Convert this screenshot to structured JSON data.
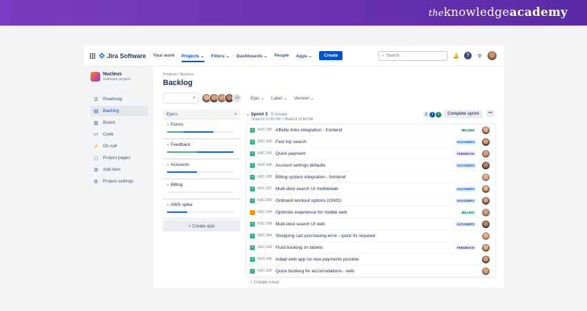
{
  "brand": {
    "part1": "the",
    "part2": "knowledge",
    "part3": "academy"
  },
  "topnav": {
    "product": "Jira Software",
    "items": [
      "Your work",
      "Projects ⌄",
      "Filters ⌄",
      "Dashboards ⌄",
      "People",
      "Apps ⌄"
    ],
    "active_index": 1,
    "create_label": "Create",
    "search_placeholder": "Search"
  },
  "sidebar": {
    "project_name": "Nucleus",
    "project_type": "Software project",
    "items": [
      {
        "label": "Roadmap",
        "icon": "roadmap-icon"
      },
      {
        "label": "Backlog",
        "icon": "backlog-icon"
      },
      {
        "label": "Board",
        "icon": "board-icon"
      },
      {
        "label": "Code",
        "icon": "code-icon"
      },
      {
        "label": "On-call",
        "icon": "on-call-icon"
      },
      {
        "label": "Project pages",
        "icon": "pages-icon"
      },
      {
        "label": "Add item",
        "icon": "add-item-icon"
      },
      {
        "label": "Project settings",
        "icon": "settings-icon"
      }
    ],
    "active_index": 1
  },
  "main": {
    "breadcrumb": "Projects / Nucleus",
    "title": "Backlog",
    "avatar_overflow": "+3",
    "filters": [
      "Epic ⌄",
      "Label ⌄",
      "Version ⌄"
    ]
  },
  "epics": {
    "header": "Epics",
    "close": "×",
    "items": [
      {
        "name": "Forms",
        "green": 0.25,
        "blue": 0.45
      },
      {
        "name": "Feedback",
        "green": 0.45,
        "blue": 0.55
      },
      {
        "name": "Accounts",
        "green": 0.0,
        "blue": 0.45
      },
      {
        "name": "Billing",
        "green": 0.0,
        "blue": 0.0
      },
      {
        "name": "AWS spike",
        "green": 0.0,
        "blue": 0.3
      }
    ],
    "create_label": "+ Create epic"
  },
  "sprint": {
    "name": "Sprint 3",
    "count": "5 issues",
    "dates": "3/Jan/19 12:58 PM • 7/Feb/19 12:58 PM",
    "counts": [
      "3",
      "2",
      "0"
    ],
    "complete_label": "Complete sprint",
    "more_label": "•••",
    "create_issue": "+ Create issue"
  },
  "issues": [
    {
      "key": "NUC-335",
      "title": "Affelite links integration - frontend",
      "label": "BILLING",
      "type": "story"
    },
    {
      "key": "NUC-342",
      "title": "Fast trip search",
      "label": "ACCOUNTS",
      "type": "story"
    },
    {
      "key": "NUC-341",
      "title": "Quick payment",
      "label": "FEEDBACK",
      "type": "story"
    },
    {
      "key": "NUC-340",
      "title": "Account settings defaults",
      "label": "ACCOUNTS",
      "type": "story"
    },
    {
      "key": "NUC-336",
      "title": "Billing system integration - frontend",
      "label": "",
      "type": "story"
    },
    {
      "key": "NUC-337",
      "title": "Multi-dest search UI mobileweb",
      "label": "ACCOUNTS",
      "type": "story"
    },
    {
      "key": "NUC-360",
      "title": "Onboard workout options (OWO)",
      "label": "ACCOUNTS",
      "type": "story"
    },
    {
      "key": "NUC-344",
      "title": "Optimize experience for mobile web",
      "label": "BILLING",
      "type": "bug"
    },
    {
      "key": "NUC-338",
      "title": "Multi-dest search UI web",
      "label": "ACCOUNTS",
      "type": "story"
    },
    {
      "key": "NUC-354",
      "title": "Shopping cart purchasing error - quick fix required.",
      "label": "",
      "type": "story"
    },
    {
      "key": "NUC-343",
      "title": "Fluid booking on tablets",
      "label": "FEEDBACK",
      "type": "story"
    },
    {
      "key": "NUC-346",
      "title": "Adapt web app no new payments provider",
      "label": "",
      "type": "story"
    },
    {
      "key": "NUC-336",
      "title": "Quick booking for accomodations - web",
      "label": "",
      "type": "story"
    }
  ],
  "label_colors": {
    "BILLING": {
      "bg": "#e3fcef",
      "fg": "#006644"
    },
    "ACCOUNTS": {
      "bg": "#deebff",
      "fg": "#0747a6"
    },
    "FEEDBACK": {
      "bg": "#eae6ff",
      "fg": "#403294"
    }
  },
  "colors": {
    "accent": "#0052cc",
    "banner": "#6a34b6",
    "green": "#36b37e"
  }
}
